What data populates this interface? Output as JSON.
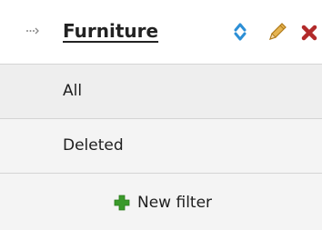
{
  "header": {
    "title": "Furniture",
    "arrow_icon": "dotted-right-arrow-icon",
    "actions": {
      "sort_icon": "sort-up-down-icon",
      "edit_icon": "pencil-icon",
      "delete_icon": "delete-x-icon"
    }
  },
  "filters": [
    {
      "label": "All"
    },
    {
      "label": "Deleted"
    }
  ],
  "new_filter": {
    "label": "New filter",
    "icon": "plus-icon"
  },
  "colors": {
    "sort": "#2c8fd6",
    "pencil": "#d49a2a",
    "delete": "#b22a2a",
    "plus": "#3a9a2a"
  }
}
